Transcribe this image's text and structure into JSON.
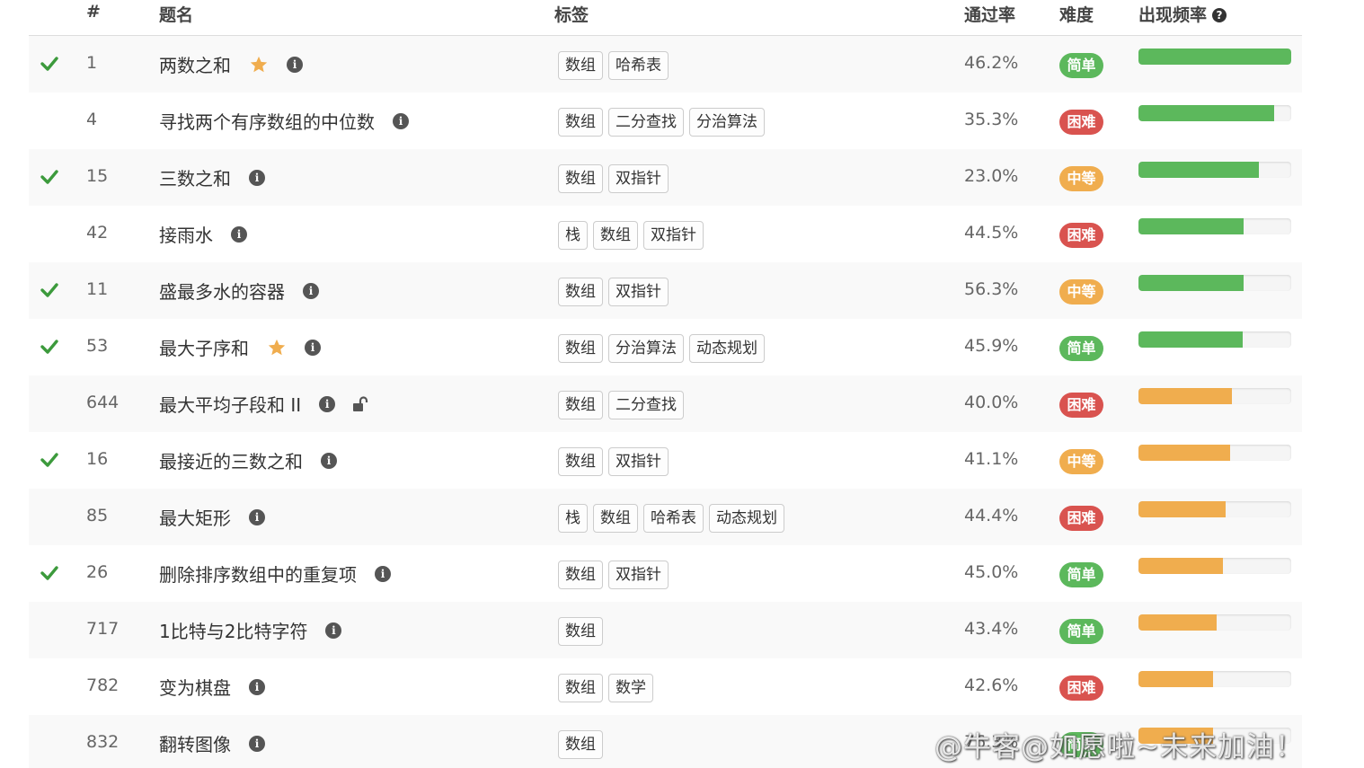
{
  "colors": {
    "easy": "#5cb85c",
    "medium": "#f0ad4e",
    "hard": "#d9534f",
    "check": "#3c9a3c",
    "star": "#f0ad4e",
    "bar_green": "#5cb85c",
    "bar_orange": "#f0ad4e"
  },
  "header": {
    "num": "#",
    "title": "题名",
    "tags": "标签",
    "rate": "通过率",
    "difficulty": "难度",
    "frequency": "出现频率",
    "frequency_help_icon": "question-circle-icon"
  },
  "rows": [
    {
      "solved": true,
      "num": "1",
      "title": "两数之和",
      "starred": true,
      "locked": false,
      "tags": [
        "数组",
        "哈希表"
      ],
      "rate": "46.2%",
      "difficulty": "简单",
      "level": "easy",
      "freq": 1.0,
      "bar": "green"
    },
    {
      "solved": false,
      "num": "4",
      "title": "寻找两个有序数组的中位数",
      "starred": false,
      "locked": false,
      "tags": [
        "数组",
        "二分查找",
        "分治算法"
      ],
      "rate": "35.3%",
      "difficulty": "困难",
      "level": "hard",
      "freq": 0.89,
      "bar": "green"
    },
    {
      "solved": true,
      "num": "15",
      "title": "三数之和",
      "starred": false,
      "locked": false,
      "tags": [
        "数组",
        "双指针"
      ],
      "rate": "23.0%",
      "difficulty": "中等",
      "level": "medium",
      "freq": 0.79,
      "bar": "green"
    },
    {
      "solved": false,
      "num": "42",
      "title": "接雨水",
      "starred": false,
      "locked": false,
      "tags": [
        "栈",
        "数组",
        "双指针"
      ],
      "rate": "44.5%",
      "difficulty": "困难",
      "level": "hard",
      "freq": 0.69,
      "bar": "green"
    },
    {
      "solved": true,
      "num": "11",
      "title": "盛最多水的容器",
      "starred": false,
      "locked": false,
      "tags": [
        "数组",
        "双指针"
      ],
      "rate": "56.3%",
      "difficulty": "中等",
      "level": "medium",
      "freq": 0.69,
      "bar": "green"
    },
    {
      "solved": true,
      "num": "53",
      "title": "最大子序和",
      "starred": true,
      "locked": false,
      "tags": [
        "数组",
        "分治算法",
        "动态规划"
      ],
      "rate": "45.9%",
      "difficulty": "简单",
      "level": "easy",
      "freq": 0.68,
      "bar": "green"
    },
    {
      "solved": false,
      "num": "644",
      "title": "最大平均子段和 II",
      "starred": false,
      "locked": true,
      "tags": [
        "数组",
        "二分查找"
      ],
      "rate": "40.0%",
      "difficulty": "困难",
      "level": "hard",
      "freq": 0.61,
      "bar": "orange"
    },
    {
      "solved": true,
      "num": "16",
      "title": "最接近的三数之和",
      "starred": false,
      "locked": false,
      "tags": [
        "数组",
        "双指针"
      ],
      "rate": "41.1%",
      "difficulty": "中等",
      "level": "medium",
      "freq": 0.6,
      "bar": "orange"
    },
    {
      "solved": false,
      "num": "85",
      "title": "最大矩形",
      "starred": false,
      "locked": false,
      "tags": [
        "栈",
        "数组",
        "哈希表",
        "动态规划"
      ],
      "rate": "44.4%",
      "difficulty": "困难",
      "level": "hard",
      "freq": 0.57,
      "bar": "orange"
    },
    {
      "solved": true,
      "num": "26",
      "title": "删除排序数组中的重复项",
      "starred": false,
      "locked": false,
      "tags": [
        "数组",
        "双指针"
      ],
      "rate": "45.0%",
      "difficulty": "简单",
      "level": "easy",
      "freq": 0.55,
      "bar": "orange"
    },
    {
      "solved": false,
      "num": "717",
      "title": "1比特与2比特字符",
      "starred": false,
      "locked": false,
      "tags": [
        "数组"
      ],
      "rate": "43.4%",
      "difficulty": "简单",
      "level": "easy",
      "freq": 0.51,
      "bar": "orange"
    },
    {
      "solved": false,
      "num": "782",
      "title": "变为棋盘",
      "starred": false,
      "locked": false,
      "tags": [
        "数组",
        "数学"
      ],
      "rate": "42.6%",
      "difficulty": "困难",
      "level": "hard",
      "freq": 0.49,
      "bar": "orange"
    },
    {
      "solved": false,
      "num": "832",
      "title": "翻转图像",
      "starred": false,
      "locked": false,
      "tags": [
        "数组"
      ],
      "rate": "76.3%",
      "difficulty": "简单",
      "level": "easy",
      "freq": 0.49,
      "bar": "orange"
    }
  ],
  "watermark": "@牛客@如愿啦~未来加油！"
}
